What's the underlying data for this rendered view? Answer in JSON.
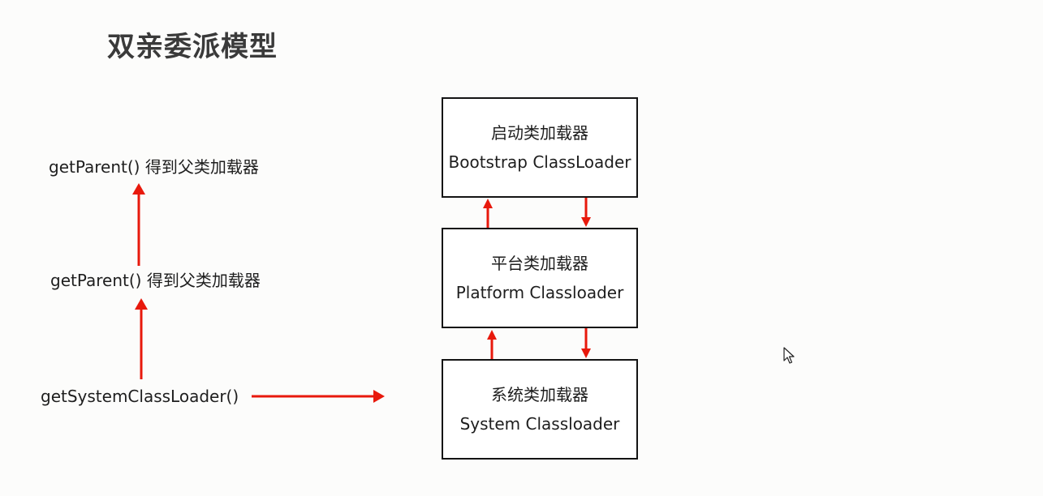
{
  "title": "双亲委派模型",
  "left_labels": {
    "get_parent_top": "getParent() 得到父类加载器",
    "get_parent_mid": "getParent() 得到父类加载器",
    "get_system": "getSystemClassLoader()"
  },
  "loaders": {
    "bootstrap": {
      "cn": "启动类加载器",
      "en": "Bootstrap ClassLoader"
    },
    "platform": {
      "cn": "平台类加载器",
      "en": "Platform Classloader"
    },
    "system": {
      "cn": "系统类加载器",
      "en": "System Classloader"
    }
  },
  "colors": {
    "arrow": "#e8190c",
    "box_border": "#141414",
    "background": "#fcfcfb"
  },
  "icons": {
    "cursor": "mouse-pointer-icon"
  }
}
